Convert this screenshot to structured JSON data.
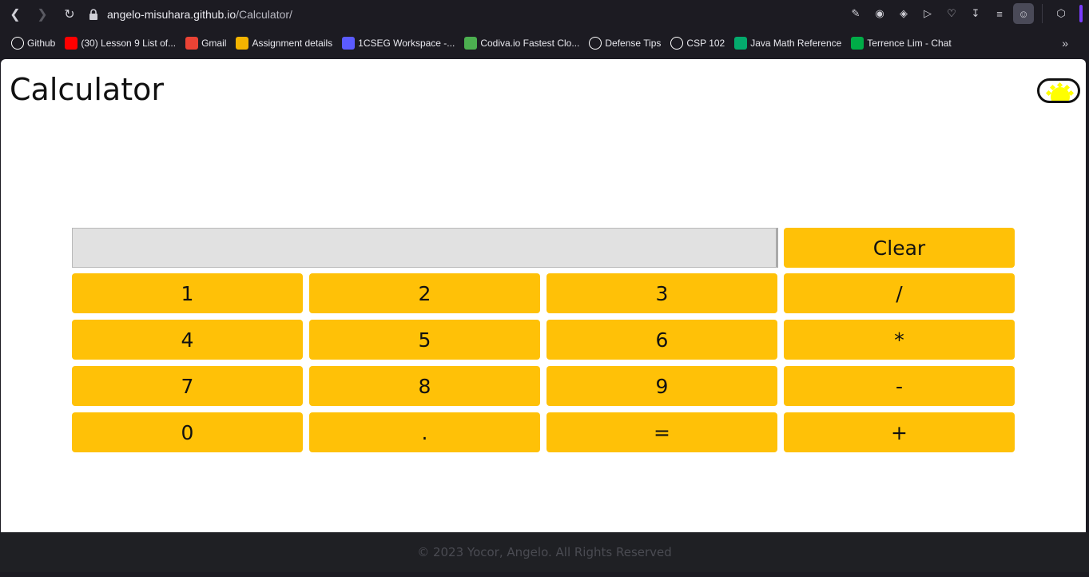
{
  "browser": {
    "url_host": "angelo-misuhara.github.io",
    "url_path": "/Calculator/",
    "bookmarks": [
      {
        "label": "Github",
        "icon": "github-icon",
        "color": "#ffffff"
      },
      {
        "label": "(30) Lesson 9 List of...",
        "icon": "youtube-icon",
        "color": "#ff0000"
      },
      {
        "label": "Gmail",
        "icon": "gmail-icon",
        "color": "#ea4335"
      },
      {
        "label": "Assignment details",
        "icon": "classroom-icon",
        "color": "#f4b400"
      },
      {
        "label": "1CSEG Workspace -...",
        "icon": "workspace-icon",
        "color": "#5b5bff"
      },
      {
        "label": "Codiva.io Fastest Clo...",
        "icon": "codiva-icon",
        "color": "#4caf50"
      },
      {
        "label": "Defense Tips",
        "icon": "notion-icon",
        "color": "#ffffff"
      },
      {
        "label": "CSP 102",
        "icon": "notion-icon",
        "color": "#ffffff"
      },
      {
        "label": "Java Math Reference",
        "icon": "w3-icon",
        "color": "#04aa6d"
      },
      {
        "label": "Terrence Lim - Chat",
        "icon": "chat-icon",
        "color": "#00ac47"
      }
    ]
  },
  "page": {
    "title": "Calculator",
    "display_value": "",
    "clear_label": "Clear",
    "keys": [
      [
        "1",
        "2",
        "3",
        "/"
      ],
      [
        "4",
        "5",
        "6",
        "*"
      ],
      [
        "7",
        "8",
        "9",
        "-"
      ],
      [
        "0",
        ".",
        "=",
        "+"
      ]
    ],
    "accent_color": "#ffc107",
    "footer": "© 2023 Yocor, Angelo. All Rights Reserved"
  }
}
